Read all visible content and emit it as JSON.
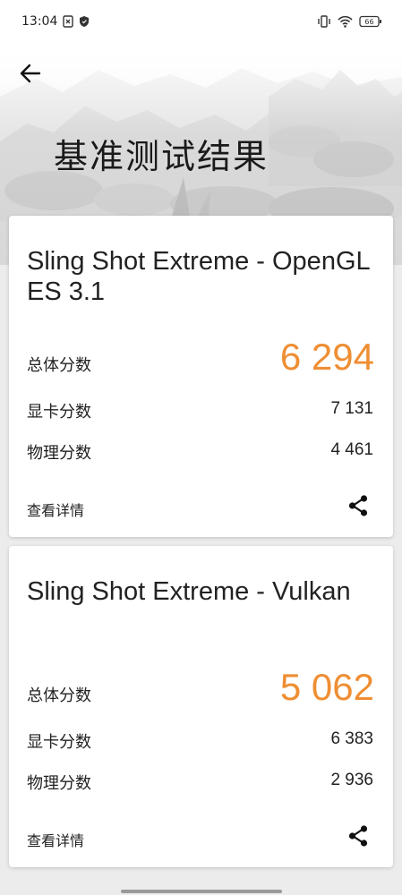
{
  "status_bar": {
    "time": "13:04",
    "battery": "66"
  },
  "header": {
    "title": "基准测试结果"
  },
  "results": [
    {
      "test_name": "Sling Shot Extreme - OpenGL ES 3.1",
      "overall_label": "总体分数",
      "overall_score": "6 294",
      "graphics_label": "显卡分数",
      "graphics_score": "7 131",
      "physics_label": "物理分数",
      "physics_score": "4 461",
      "details_label": "查看详情"
    },
    {
      "test_name": "Sling Shot Extreme - Vulkan",
      "overall_label": "总体分数",
      "overall_score": "5 062",
      "graphics_label": "显卡分数",
      "graphics_score": "6 383",
      "physics_label": "物理分数",
      "physics_score": "2 936",
      "details_label": "查看详情"
    }
  ],
  "colors": {
    "accent": "#ef8e33",
    "card": "#ffffff",
    "background": "#ececec"
  }
}
